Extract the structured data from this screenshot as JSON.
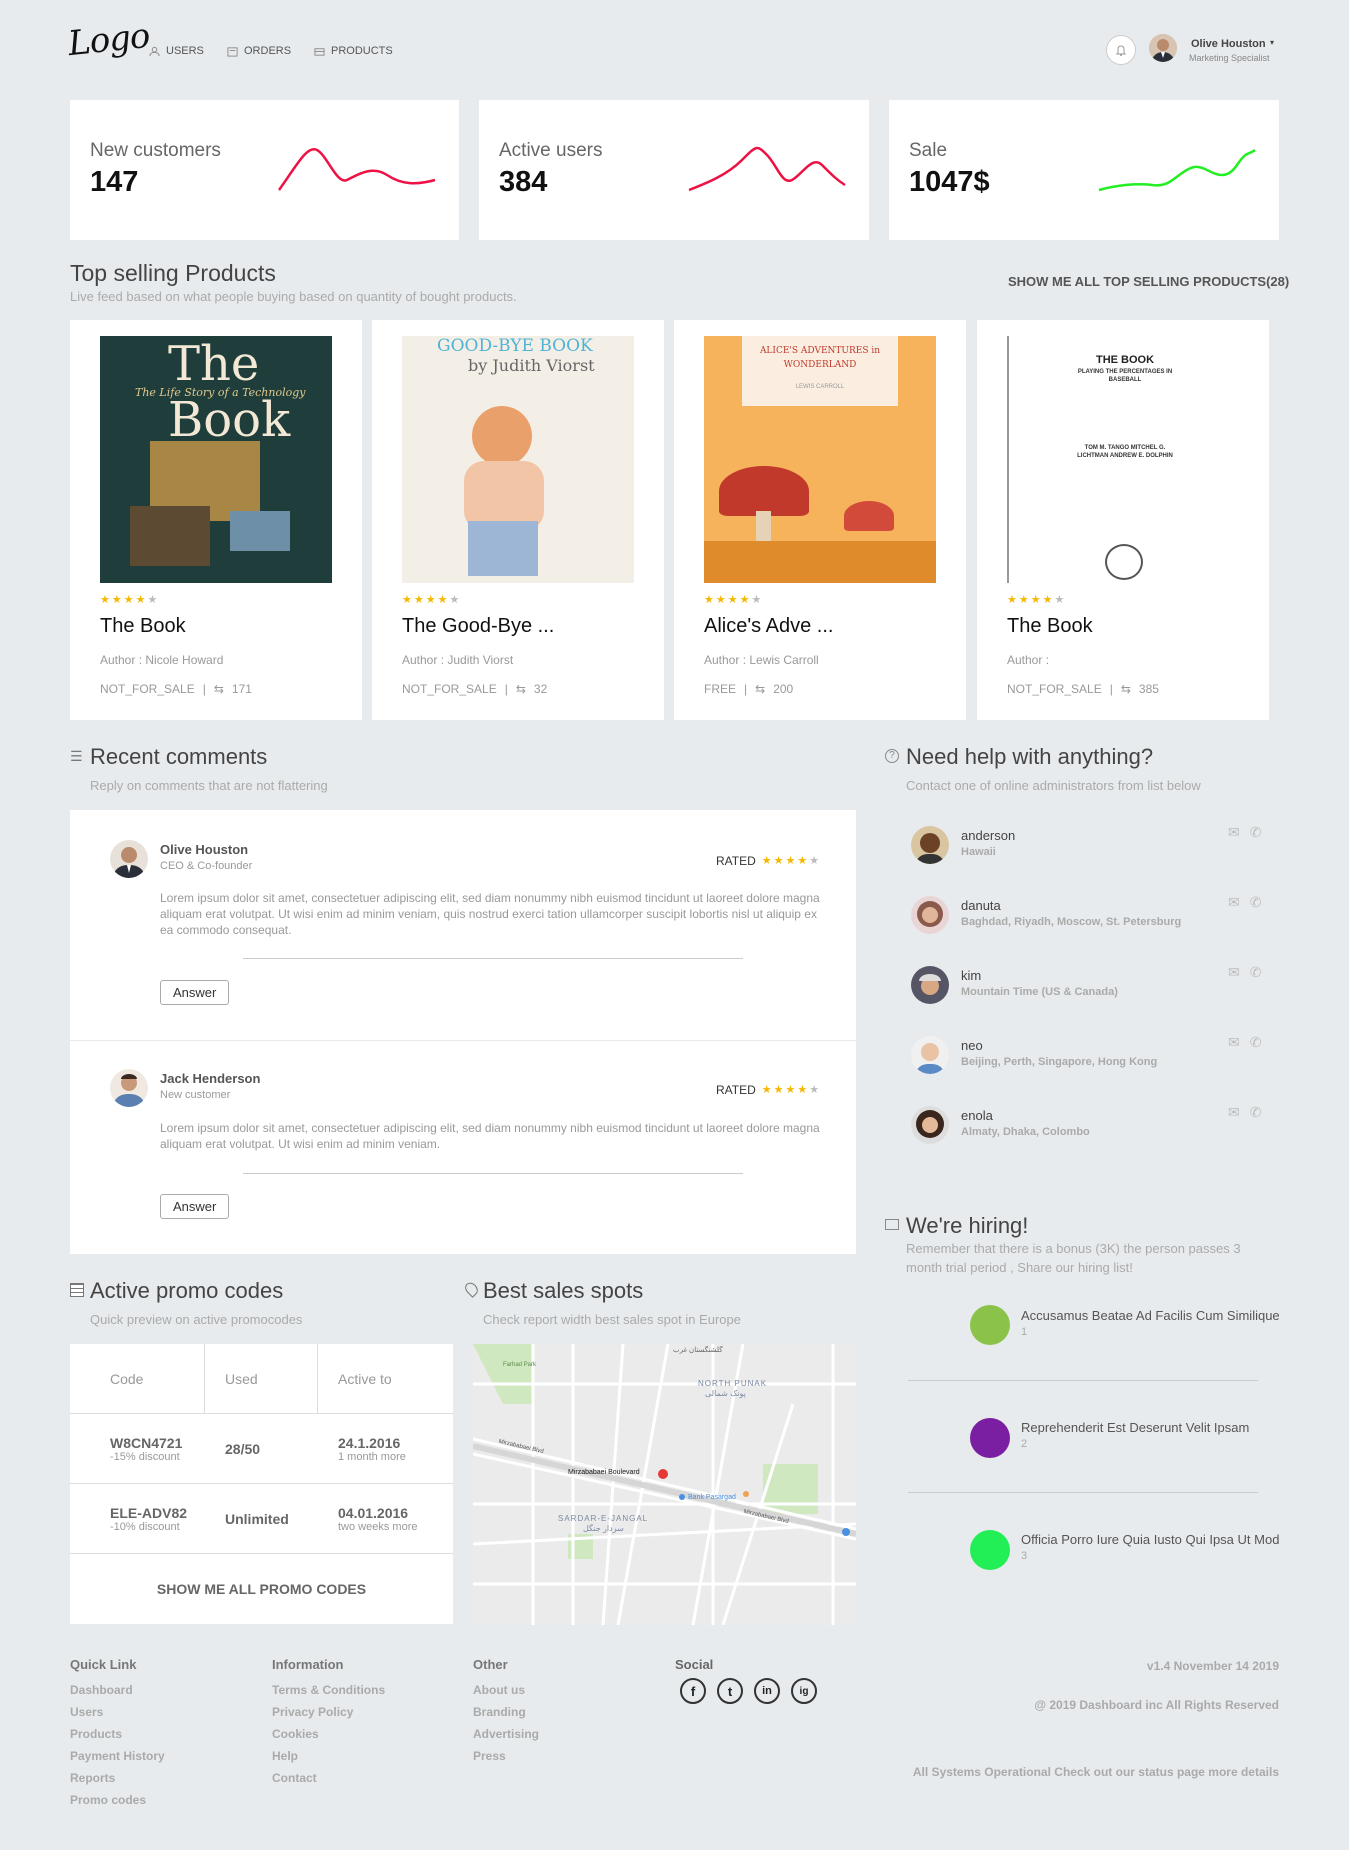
{
  "header": {
    "logo_text": "Logo",
    "nav": [
      {
        "label": "USERS",
        "icon": "users-icon"
      },
      {
        "label": "ORDERS",
        "icon": "orders-icon"
      },
      {
        "label": "PRODUCTS",
        "icon": "products-icon"
      }
    ],
    "user": {
      "name": "Olive Houston",
      "role": "Marketing Specialist"
    }
  },
  "stats": [
    {
      "label": "New customers",
      "value": "147",
      "color": "#ee1144"
    },
    {
      "label": "Active users",
      "value": "384",
      "color": "#ee1144"
    },
    {
      "label": "Sale",
      "value": "1047$",
      "color": "#22dd22"
    }
  ],
  "top_products": {
    "title": "Top selling Products",
    "subtitle": "Live feed based on what people buying based on quantity of bought products.",
    "show_all": "SHOW ME ALL TOP SELLING PRODUCTS(28)",
    "items": [
      {
        "title": "The Book",
        "author": "Author : Nicole Howard",
        "status": "NOT_FOR_SALE",
        "count": "171",
        "rating": 4,
        "cover": {
          "line1": "The Book",
          "line2": "The Life Story of a Technology"
        }
      },
      {
        "title": "The Good-Bye ...",
        "author": "Author : Judith Viorst",
        "status": "NOT_FOR_SALE",
        "count": "32",
        "rating": 4,
        "cover": {
          "line1": "GOOD-BYE BOOK",
          "line2": "by Judith Viorst"
        }
      },
      {
        "title": "Alice's Adve ...",
        "author": "Author : Lewis Carroll",
        "status": "FREE",
        "count": "200",
        "rating": 4,
        "cover": {
          "line1": "ALICE'S ADVENTURES in WONDERLAND",
          "line2": "LEWIS CARROLL"
        }
      },
      {
        "title": "The Book",
        "author": "Author :",
        "status": "NOT_FOR_SALE",
        "count": "385",
        "rating": 4,
        "cover": {
          "line1": "THE BOOK",
          "line2": "PLAYING THE PERCENTAGES IN BASEBALL",
          "line3": "TOM M. TANGO  MITCHEL G. LICHTMAN  ANDREW E. DOLPHIN"
        }
      }
    ]
  },
  "comments": {
    "title": "Recent comments",
    "subtitle": "Reply on comments that are not flattering",
    "rated_label": "RATED",
    "answer_label": "Answer",
    "items": [
      {
        "name": "Olive Houston",
        "role": "CEO & Co-founder",
        "rating": 4,
        "text": "Lorem ipsum dolor sit amet, consectetuer adipiscing elit, sed diam nonummy nibh euismod tincidunt ut laoreet dolore magna aliquam erat volutpat. Ut wisi enim ad minim veniam, quis nostrud exerci tation ullamcorper suscipit lobortis nisl ut aliquip ex ea commodo consequat."
      },
      {
        "name": "Jack Henderson",
        "role": "New customer",
        "rating": 4,
        "text": "Lorem ipsum dolor sit amet, consectetuer adipiscing elit, sed diam nonummy nibh euismod tincidunt ut laoreet dolore magna aliquam erat volutpat. Ut wisi enim ad minim veniam."
      }
    ]
  },
  "help": {
    "title": "Need help with anything?",
    "subtitle": "Contact one of online administrators from list below",
    "admins": [
      {
        "name": "anderson",
        "location": "Hawaii"
      },
      {
        "name": "danuta",
        "location": "Baghdad, Riyadh, Moscow, St. Petersburg"
      },
      {
        "name": "kim",
        "location": "Mountain Time (US & Canada)"
      },
      {
        "name": "neo",
        "location": "Beijing, Perth, Singapore, Hong Kong"
      },
      {
        "name": "enola",
        "location": "Almaty, Dhaka, Colombo"
      }
    ]
  },
  "hiring": {
    "title": "We're hiring!",
    "subtitle": "Remember that there is a bonus (3K) the person passes 3 month trial period , Share our hiring list!",
    "jobs": [
      {
        "title": "Accusamus Beatae Ad Facilis Cum Similique",
        "num": "1",
        "color": "#8bc34a"
      },
      {
        "title": "Reprehenderit Est Deserunt Velit Ipsam",
        "num": "2",
        "color": "#7b1fa2"
      },
      {
        "title": "Officia Porro Iure Quia Iusto Qui Ipsa Ut Modi",
        "num": "3",
        "color": "#22ee55"
      }
    ]
  },
  "promo": {
    "title": "Active promo codes",
    "subtitle": "Quick preview on active promocodes",
    "columns": [
      "Code",
      "Used",
      "Active to"
    ],
    "rows": [
      {
        "code": "W8CN4721",
        "discount": "-15% discount",
        "used": "28/50",
        "date": "24.1.2016",
        "remaining": "1 month more"
      },
      {
        "code": "ELE-ADV82",
        "discount": "-10% discount",
        "used": "Unlimited",
        "date": "04.01.2016",
        "remaining": "two weeks more"
      }
    ],
    "show_all": "SHOW ME ALL PROMO CODES"
  },
  "sales": {
    "title": "Best sales spots",
    "subtitle": "Check report width best sales spot in Europe",
    "map": {
      "pin_label": "Mirzababaei Boulevard",
      "district1": "NORTH PUNAK",
      "district2": "SARDAR-E-JANGAL",
      "poi": "Bank Pasargad",
      "park": "Farhad Park",
      "road1": "Mirzababaei Blvd",
      "road2": "Mirzababaei Blvd",
      "fa1": "گلشنگستان غرب",
      "fa2": "پونک شمالی",
      "fa3": "سردار جنگل"
    }
  },
  "footer": {
    "columns": [
      {
        "title": "Quick Link",
        "links": [
          "Dashboard",
          "Users",
          "Products",
          "Payment History",
          "Reports",
          "Promo codes"
        ]
      },
      {
        "title": "Information",
        "links": [
          "Terms & Conditions",
          "Privacy Policy",
          "Cookies",
          "Help",
          "Contact"
        ]
      },
      {
        "title": "Other",
        "links": [
          "About us",
          "Branding",
          "Advertising",
          "Press"
        ]
      }
    ],
    "social_title": "Social",
    "social": [
      "f",
      "t",
      "in",
      "ig"
    ],
    "version": "v1.4 November 14 2019",
    "copyright": "@ 2019 Dashboard inc All Rights Reserved",
    "status": "All Systems Operational Check out our status page more details"
  }
}
